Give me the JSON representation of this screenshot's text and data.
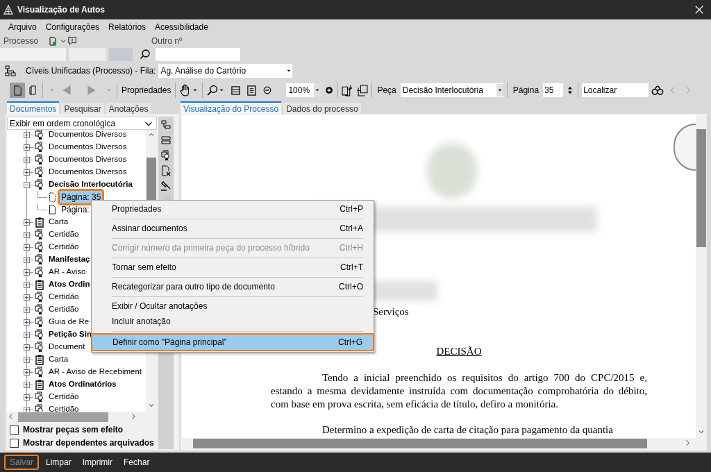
{
  "window": {
    "title": "Visualização de Autos"
  },
  "menu": [
    "Arquivo",
    "Configurações",
    "Relatórios",
    "Acessibilidade"
  ],
  "process": {
    "label": "Processo",
    "other_label": "Outro nº"
  },
  "queue": {
    "label": "Cíveis Unificadas (Processo) - Fila:",
    "value": "Ag. Análise do Cartório"
  },
  "toolbar": {
    "properties": "Propriedades",
    "zoom": "100%",
    "piece_label": "Peça",
    "piece": "Decisão Interlocutória",
    "page_label": "Página",
    "page": "35",
    "find": "Localizar"
  },
  "left_tabs": [
    {
      "label": "Documentos",
      "selected": true
    },
    {
      "label": "Pesquisar",
      "selected": false
    },
    {
      "label": "Anotações",
      "selected": false
    }
  ],
  "order": "Exibir em ordem cronológica",
  "tree": [
    {
      "label": "Documentos Diversos",
      "kind": "seal",
      "bold": false,
      "expanded": false
    },
    {
      "label": "Documentos Diversos",
      "kind": "seal",
      "bold": false,
      "expanded": false
    },
    {
      "label": "Documentos Diversos",
      "kind": "seal",
      "bold": false,
      "expanded": false
    },
    {
      "label": "Documentos Diversos",
      "kind": "seal",
      "bold": false,
      "expanded": false
    },
    {
      "label": "Decisão Interlocutória",
      "kind": "seal",
      "bold": true,
      "expanded": true,
      "children": [
        {
          "label": "Página: 35",
          "selected": true
        },
        {
          "label": "Página:",
          "selected": false
        }
      ]
    },
    {
      "label": "Carta",
      "kind": "clipboard",
      "bold": false,
      "expanded": false
    },
    {
      "label": "Certidão",
      "kind": "seal",
      "bold": false,
      "expanded": false
    },
    {
      "label": "Certidão",
      "kind": "seal",
      "bold": false,
      "expanded": false
    },
    {
      "label": "Manifestaç",
      "kind": "seal",
      "bold": true,
      "expanded": false
    },
    {
      "label": "AR - Aviso",
      "kind": "seal",
      "bold": false,
      "expanded": false
    },
    {
      "label": "Atos Ordin",
      "kind": "clipboard",
      "bold": true,
      "expanded": false
    },
    {
      "label": "Certidão",
      "kind": "seal",
      "bold": false,
      "expanded": false
    },
    {
      "label": "Certidão",
      "kind": "seal",
      "bold": false,
      "expanded": false
    },
    {
      "label": "Guia de Re",
      "kind": "seal",
      "bold": false,
      "expanded": false
    },
    {
      "label": "Petição Sin",
      "kind": "seal",
      "bold": true,
      "expanded": false
    },
    {
      "label": "Document",
      "kind": "seal",
      "bold": false,
      "expanded": false
    },
    {
      "label": "Carta",
      "kind": "clipboard",
      "bold": false,
      "expanded": false
    },
    {
      "label": "AR - Aviso de Recebiment",
      "kind": "seal",
      "bold": false,
      "expanded": false
    },
    {
      "label": "Atos Ordinatórios",
      "kind": "clipboard",
      "bold": true,
      "expanded": false
    },
    {
      "label": "Certidão",
      "kind": "seal",
      "bold": false,
      "expanded": false
    },
    {
      "label": "Certidão",
      "kind": "seal",
      "bold": false,
      "expanded": false
    }
  ],
  "options": [
    {
      "label": "Mostrar peças sem efeito",
      "checked": false
    },
    {
      "label": "Mostrar dependentes arquivados",
      "checked": false
    }
  ],
  "right_tabs": [
    {
      "label": "Visualização do Processo",
      "selected": true
    },
    {
      "label": "Dados do processo",
      "selected": false
    }
  ],
  "document": {
    "fragment": "Serviços",
    "heading": "DECISÃO",
    "paragraphs": [
      "Tendo a inicial preenchido os requisitos do artigo 700 do CPC/2015 e, estando a mesma devidamente instruída com documentação comprobatória do débito, com base em prova escrita, sem eficácia de título, defiro a monitória.",
      "Determino a expedição de carta de citação para pagamento da quantia"
    ]
  },
  "context_menu": [
    {
      "label": "Propriedades",
      "shortcut": "Ctrl+P",
      "disabled": false,
      "selected": false,
      "separator": true
    },
    {
      "label": "Assinar documentos",
      "shortcut": "Ctrl+A",
      "disabled": false,
      "selected": false,
      "separator": true
    },
    {
      "label": "Corrigir número da primeira peça do processo híbrido",
      "shortcut": "Ctrl+H",
      "disabled": true,
      "selected": false,
      "separator": true
    },
    {
      "label": "Tornar sem efeito",
      "shortcut": "Ctrl+T",
      "disabled": false,
      "selected": false,
      "separator": true
    },
    {
      "label": "Recategorizar para outro tipo de documento",
      "shortcut": "Ctrl+O",
      "disabled": false,
      "selected": false,
      "separator": true
    },
    {
      "label": "Exibir / Ocultar anotações",
      "disabled": false,
      "selected": false,
      "separator": false
    },
    {
      "label": "Incluir anotação",
      "disabled": false,
      "selected": false,
      "separator": true
    },
    {
      "label": "Definir como \"Página principal\"",
      "shortcut": "Ctrl+G",
      "disabled": false,
      "selected": true,
      "separator": false
    }
  ],
  "footer": [
    {
      "label": "Salvar",
      "disabled": true
    },
    {
      "label": "Limpar",
      "disabled": false
    },
    {
      "label": "Imprimir",
      "disabled": false
    },
    {
      "label": "Fechar",
      "disabled": false
    }
  ]
}
